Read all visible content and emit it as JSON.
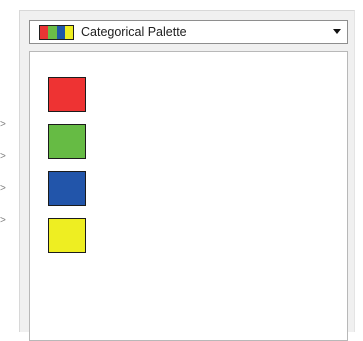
{
  "palette_combo": {
    "label": "Categorical Palette",
    "preview_colors": [
      "#ea3434",
      "#6bbc48",
      "#1f57a8",
      "#eeee22"
    ]
  },
  "colors": [
    {
      "hex": "#ee3333"
    },
    {
      "hex": "#66bb44"
    },
    {
      "hex": "#2255aa"
    },
    {
      "hex": "#eeee22"
    }
  ],
  "edge_arrows": [
    ">",
    ">",
    ">",
    ">"
  ]
}
